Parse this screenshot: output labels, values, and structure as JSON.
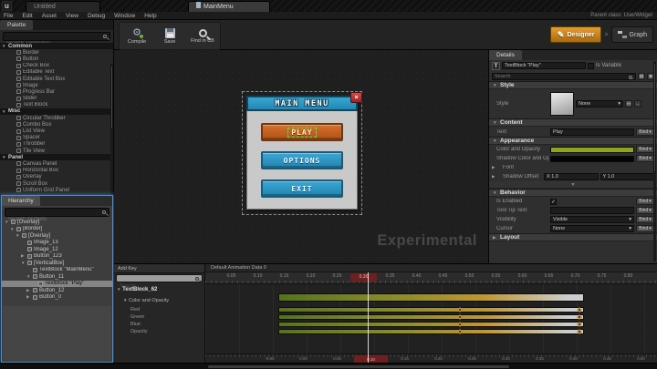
{
  "window": {
    "logo_glyph": "u",
    "tabs": [
      {
        "label": "Untitled"
      },
      {
        "label": "MainMenu",
        "active": true
      }
    ],
    "menus": [
      "File",
      "Edit",
      "Asset",
      "View",
      "Debug",
      "Window",
      "Help"
    ],
    "parent_class": "Parent class: UserWidget"
  },
  "toolbar": {
    "compile_label": "Compile",
    "save_label": "Save",
    "find_label": "Find in CB",
    "designer_label": "Designer",
    "graph_label": "Graph",
    "mode_separator": ">"
  },
  "glyphs": {
    "close": "×",
    "dropdown": "▾",
    "expanded": "▼",
    "collapsed": "▶",
    "check": "✓",
    "textblock": "T",
    "grid": "▦",
    "eye": "◉",
    "pen": "✎"
  },
  "palette": {
    "tab": "Palette",
    "search_placeholder": "Search Templates",
    "rows": [
      {
        "label": "Common",
        "cat": true,
        "arrow": "▼"
      },
      {
        "label": "Border"
      },
      {
        "label": "Button"
      },
      {
        "label": "Check Box"
      },
      {
        "label": "Editable Text"
      },
      {
        "label": "Editable Text Box"
      },
      {
        "label": "Image"
      },
      {
        "label": "Progress Bar"
      },
      {
        "label": "Slider"
      },
      {
        "label": "Text Block"
      },
      {
        "label": "Misc",
        "cat": true,
        "arrow": "▼"
      },
      {
        "label": "Circular Throbber"
      },
      {
        "label": "Combo Box"
      },
      {
        "label": "List View"
      },
      {
        "label": "Spacer"
      },
      {
        "label": "Throbber"
      },
      {
        "label": "Tile View"
      },
      {
        "label": "Panel",
        "cat": true,
        "arrow": "▼"
      },
      {
        "label": "Canvas Panel"
      },
      {
        "label": "Horizontal Box"
      },
      {
        "label": "Overlay"
      },
      {
        "label": "Scroll Box"
      },
      {
        "label": "Uniform Grid Panel"
      }
    ]
  },
  "hierarchy": {
    "tab": "Hierarchy",
    "search_placeholder": "Search Widgets",
    "items": [
      {
        "label": "[Overlay]",
        "depth": 0,
        "arrow": "▼"
      },
      {
        "label": "[Border]",
        "depth": 1,
        "arrow": "▼"
      },
      {
        "label": "[Overlay]",
        "depth": 2,
        "arrow": "▼"
      },
      {
        "label": "Image_13",
        "depth": 3,
        "arrow": ""
      },
      {
        "label": "Image_12",
        "depth": 3,
        "arrow": ""
      },
      {
        "label": "Button_123",
        "depth": 3,
        "arrow": "▶"
      },
      {
        "label": "[VerticalBox]",
        "depth": 3,
        "arrow": "▼"
      },
      {
        "label": "TextBlock \"MainMenu\"",
        "depth": 4,
        "arrow": ""
      },
      {
        "label": "Button_11",
        "depth": 4,
        "arrow": "▼"
      },
      {
        "label": "TextBlock \"Play\"",
        "depth": 5,
        "arrow": "",
        "selected": true
      },
      {
        "label": "Button_12",
        "depth": 4,
        "arrow": "▶"
      },
      {
        "label": "Button_0",
        "depth": 4,
        "arrow": "▶"
      }
    ]
  },
  "canvas": {
    "watermark": "Experimental",
    "dialog": {
      "title": "MAIN MENU",
      "buttons": [
        {
          "label": "PLAY",
          "style": "orange",
          "selected": true
        },
        {
          "label": "OPTIONS",
          "style": "blue"
        },
        {
          "label": "EXIT",
          "style": "blue"
        }
      ]
    }
  },
  "details": {
    "tab": "Details",
    "name_value": "TextBlock \"Play\"",
    "is_variable_label": "Is Variable",
    "search_placeholder": "Search",
    "bind_label": "Bind",
    "sections": {
      "style": "Style",
      "content": "Content",
      "appearance": "Appearance",
      "behavior": "Behavior",
      "layout": "Layout"
    },
    "style_label": "Style",
    "style_value": "None",
    "text_label": "Text",
    "text_value": "Play",
    "color_label": "Color and Opacity",
    "color_hex": "#8aa71e",
    "shadow_color_label": "Shadow Color and Opacity",
    "shadow_color_hex": "#050505",
    "font_label": "Font",
    "shadow_offset_label": "Shadow Offset",
    "shadow_offset_x": "X 1.0",
    "shadow_offset_y": "Y 1.0",
    "is_enabled_label": "Is Enabled",
    "tooltip_label": "Tool Tip Text",
    "visibility_label": "Visibility",
    "visibility_value": "Visible",
    "cursor_label": "Cursor",
    "cursor_value": "None"
  },
  "timeline": {
    "add_key_label": "Add Key",
    "search_placeholder": "Search",
    "animation_header": "Default Animation Data 0",
    "track_name": "TextBlock_62",
    "group_name": "Color and Opacity",
    "channels": [
      "Red",
      "Green",
      "Blue",
      "Opacity"
    ],
    "top_ruler": [
      {
        "t": "0.05"
      },
      {
        "t": "0.10"
      },
      {
        "t": "0.15"
      },
      {
        "t": "0.20"
      },
      {
        "t": "0.25"
      },
      {
        "t": "0.30",
        "current": true
      },
      {
        "t": "0.35"
      },
      {
        "t": "0.40"
      },
      {
        "t": "0.45"
      },
      {
        "t": "0.50"
      },
      {
        "t": "0.55"
      },
      {
        "t": "0.60"
      },
      {
        "t": "0.65"
      },
      {
        "t": "0.70"
      },
      {
        "t": "0.75"
      },
      {
        "t": "0.80"
      }
    ],
    "bottom_ruler": [
      {
        "t": "-0.05"
      },
      {
        "t": "0.00"
      },
      {
        "t": "0.05"
      },
      {
        "t": "0.10",
        "current": true
      },
      {
        "t": "0.15"
      },
      {
        "t": "0.20"
      },
      {
        "t": "0.25"
      },
      {
        "t": "0.30"
      },
      {
        "t": "0.35"
      },
      {
        "t": "0.40"
      },
      {
        "t": "0.45"
      },
      {
        "t": "0.50"
      }
    ]
  }
}
